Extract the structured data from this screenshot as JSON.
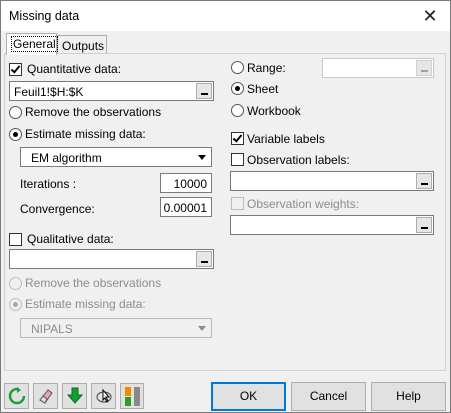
{
  "window": {
    "title": "Missing data"
  },
  "tabs": [
    {
      "label": "General",
      "active": true
    },
    {
      "label": "Outputs",
      "active": false
    }
  ],
  "general": {
    "quantitative": {
      "label": "Quantitative data:",
      "checked": true,
      "range": "Feuil1!$H:$K"
    },
    "quant_options": [
      {
        "label": "Remove the observations",
        "selected": false
      },
      {
        "label": "Estimate missing data:",
        "selected": true
      }
    ],
    "method": {
      "selected": "EM algorithm"
    },
    "iterations": {
      "label": "Iterations :",
      "value": "10000"
    },
    "convergence": {
      "label": "Convergence:",
      "value": "0.00001"
    },
    "qualitative": {
      "label": "Qualitative data:",
      "checked": false,
      "range": ""
    },
    "qual_options": [
      {
        "label": "Remove the observations",
        "selected": false,
        "disabled": true
      },
      {
        "label": "Estimate missing data:",
        "selected": true,
        "disabled": true
      }
    ],
    "qual_method": {
      "selected": "NIPALS",
      "disabled": true
    },
    "output_target": [
      {
        "label": "Range:",
        "selected": false
      },
      {
        "label": "Sheet",
        "selected": true
      },
      {
        "label": "Workbook",
        "selected": false
      }
    ],
    "variable_labels": {
      "label": "Variable labels",
      "checked": true
    },
    "observation_labels": {
      "label": "Observation labels:",
      "checked": false
    },
    "observation_weights": {
      "label": "Observation weights:",
      "checked": false,
      "disabled": true
    }
  },
  "footer": {
    "icons": [
      "reset-icon",
      "eraser-icon",
      "download-arrow-icon",
      "select-cursor-icon",
      "layout-toggle-icon"
    ],
    "ok": "OK",
    "cancel": "Cancel",
    "help": "Help"
  },
  "colors": {
    "accent": "#0078d7",
    "reset_green": "#1e9e3a",
    "arrow_green": "#10a030",
    "toggle_orange": "#f08a00",
    "toggle_green": "#2aa02a"
  }
}
